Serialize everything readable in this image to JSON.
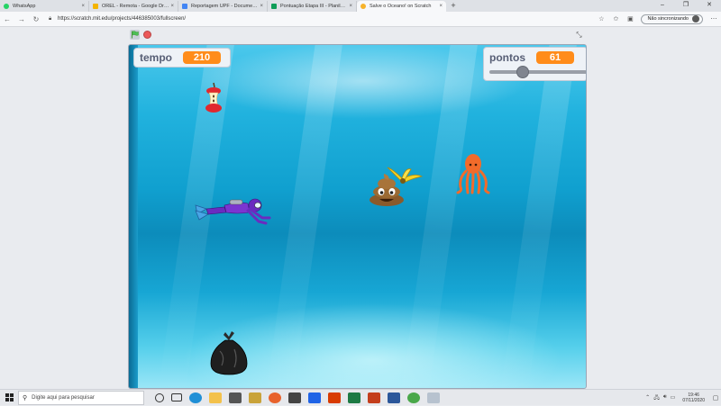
{
  "browser": {
    "tabs": [
      {
        "label": "WhatsApp",
        "color": "#25d366",
        "active": false
      },
      {
        "label": "OREL - Remota - Google Drive",
        "color": "#f4b400",
        "active": false
      },
      {
        "label": "Reportagem UPF - Documentos",
        "color": "#4285f4",
        "active": false
      },
      {
        "label": "Pontuação Etapa III - Planilhas G",
        "color": "#0f9d58",
        "active": false
      },
      {
        "label": "Salve o Oceano! on Scratch",
        "color": "#f7b32b",
        "active": true
      }
    ],
    "url": "https://scratch.mit.edu/projects/446385003/fullscreen/",
    "sync_label": "Não sincronizando"
  },
  "game": {
    "tempo_label": "tempo",
    "tempo_value": "210",
    "pontos_label": "pontos",
    "pontos_value": "61",
    "pontos_slider_fraction": 0.32
  },
  "taskbar": {
    "search_placeholder": "Digite aqui para pesquisar",
    "time": "19:46",
    "date": "07/11/2020"
  }
}
